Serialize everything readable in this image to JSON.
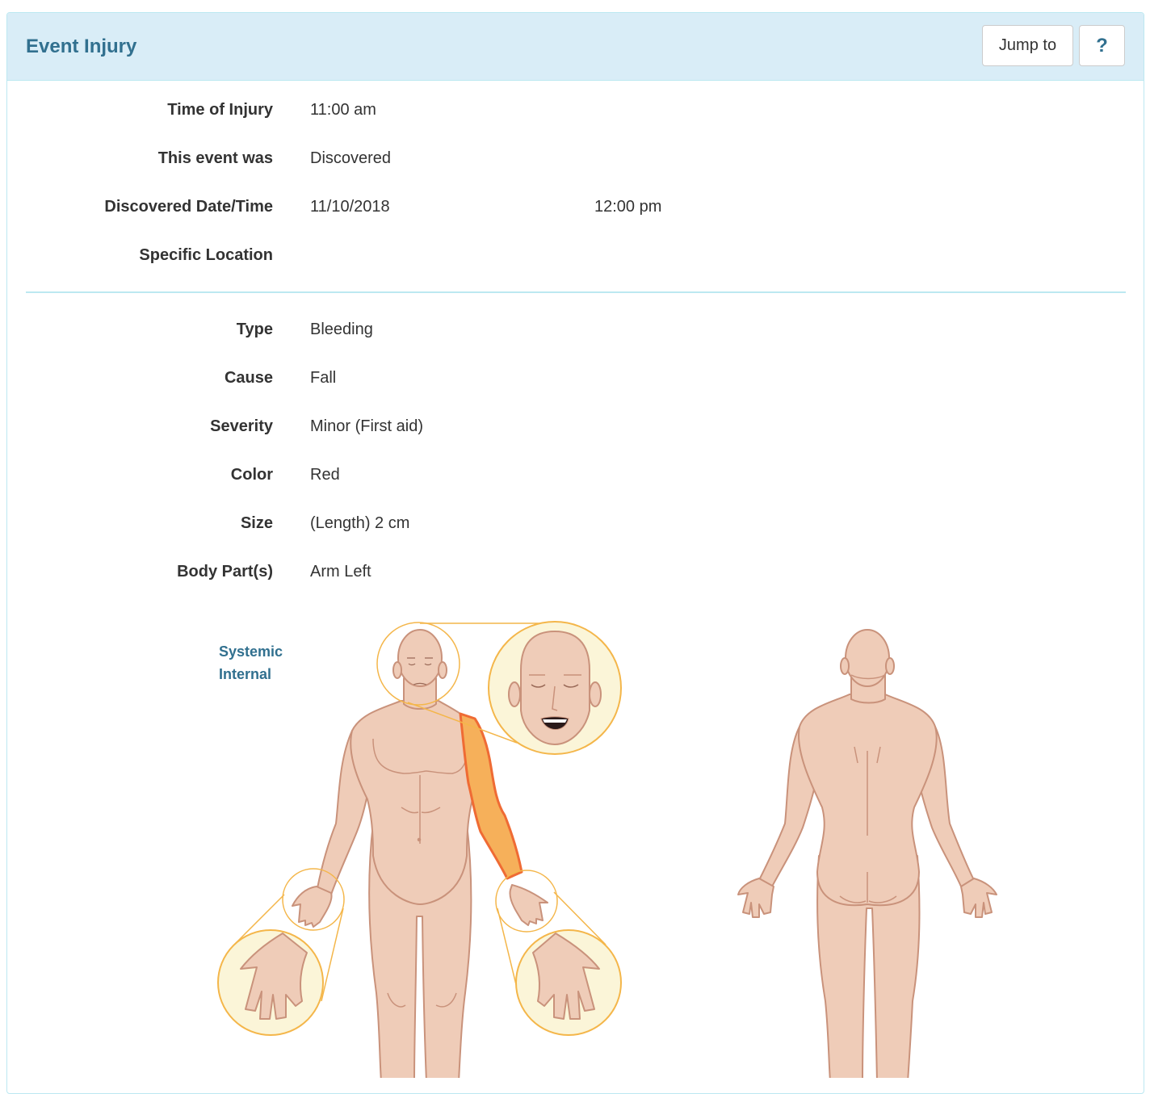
{
  "panel": {
    "title": "Event Injury",
    "jump_label": "Jump to",
    "help_label": "?"
  },
  "fields": {
    "time_of_injury": {
      "label": "Time of Injury",
      "value": "11:00 am"
    },
    "event_was": {
      "label": "This event was",
      "value": "Discovered"
    },
    "discovered": {
      "label": "Discovered Date/Time",
      "date": "11/10/2018",
      "time": "12:00 pm"
    },
    "specific_location": {
      "label": "Specific Location",
      "value": ""
    },
    "type": {
      "label": "Type",
      "value": "Bleeding"
    },
    "cause": {
      "label": "Cause",
      "value": "Fall"
    },
    "severity": {
      "label": "Severity",
      "value": "Minor (First aid)"
    },
    "color": {
      "label": "Color",
      "value": "Red"
    },
    "size": {
      "label": "Size",
      "value": "(Length) 2 cm"
    },
    "body_parts": {
      "label": "Body Part(s)",
      "value": "Arm Left"
    }
  },
  "body_map": {
    "links": [
      "Systemic",
      "Internal"
    ],
    "selected_part": "arm-left",
    "colors": {
      "skin": "#efccb8",
      "outline": "#c9927b",
      "highlight_fill": "#f6b05a",
      "highlight_stroke": "#ef6b34",
      "zoom_fill": "#fbf5d8",
      "zoom_stroke": "#f4b64a"
    }
  }
}
